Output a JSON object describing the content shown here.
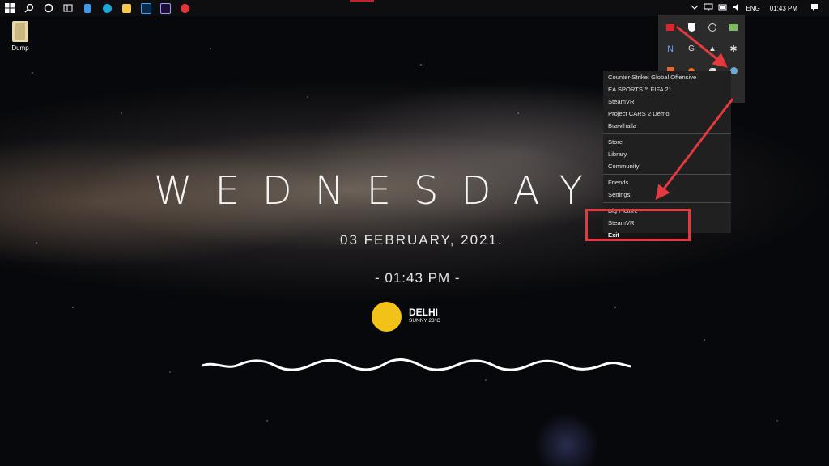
{
  "desktop": {
    "icon_label": "Dump"
  },
  "taskbar": {
    "start_icon": "windows-logo",
    "pinned_icons": [
      "search-icon",
      "cortana-icon",
      "task-view-icon",
      "file-icon",
      "edge-icon",
      "file-explorer-icon",
      "photoshop-icon",
      "premiere-icon",
      "record-icon"
    ],
    "tray_language": "ENG",
    "clock": "01:43 PM",
    "accent_color": "#c6212a"
  },
  "tray_overflow": {
    "icons": [
      "amd-icon",
      "shield-icon",
      "steelseries-icon",
      "nvidia-icon",
      "nu-icon",
      "g-icon",
      "a-icon",
      "slack-icon",
      "html-icon",
      "origin-icon",
      "discord-icon",
      "steam-icon"
    ]
  },
  "steam_menu": {
    "games": [
      "Counter-Strike: Global Offensive",
      "EA SPORTS™ FIFA 21",
      "SteamVR",
      "Project CARS 2 Demo",
      "Brawlhalla"
    ],
    "nav": [
      "Store",
      "Library",
      "Community"
    ],
    "account": [
      "Friends",
      "Settings"
    ],
    "modes": [
      "Big Picture",
      "SteamVR"
    ],
    "exit": "Exit"
  },
  "widget": {
    "weekday": "WEDNESDAY",
    "date": "03 FEBRUARY, 2021.",
    "time": "- 01:43 PM -",
    "city": "DELHI",
    "weather": "SUNNY 23°C",
    "sun_color": "#f3c218"
  },
  "annotation_color": "#e43a3f"
}
